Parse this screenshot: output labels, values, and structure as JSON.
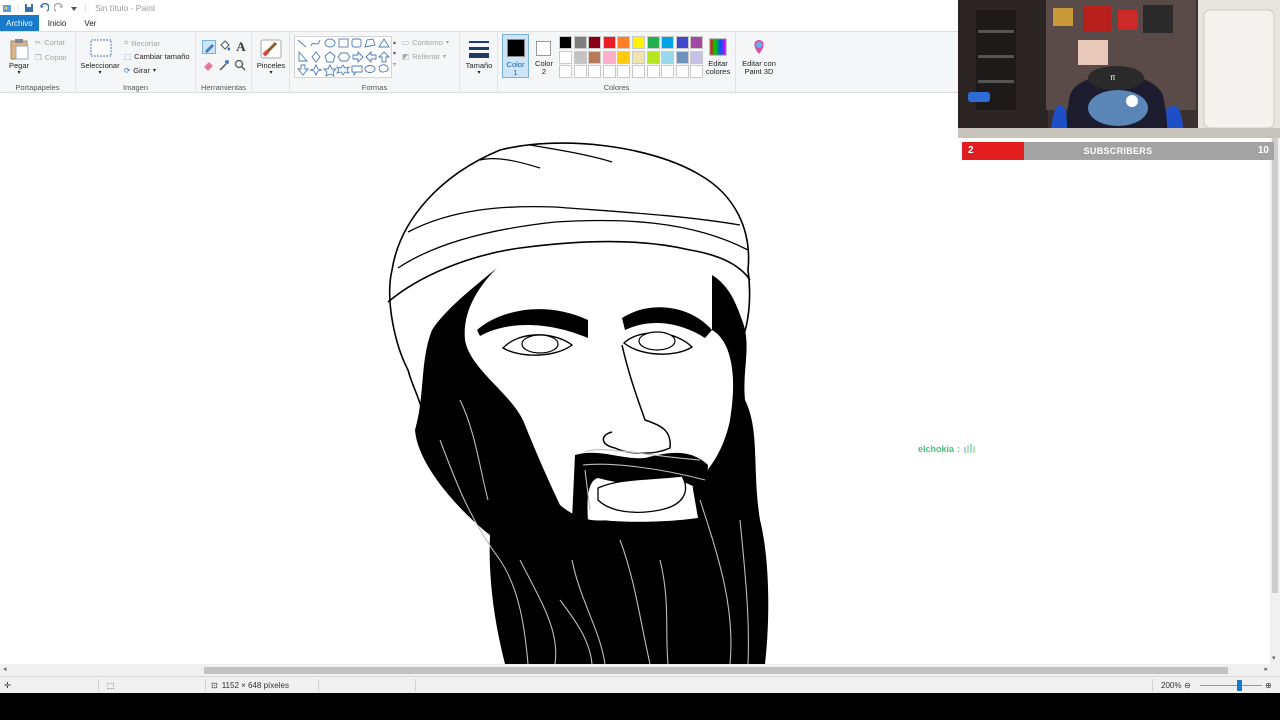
{
  "window": {
    "title": "Sin título - Paint"
  },
  "tabs": {
    "file": "Archivo",
    "home": "Inicio",
    "view": "Ver"
  },
  "ribbon": {
    "clipboard": {
      "paste": "Pegar",
      "cut": "Cortar",
      "copy": "Copiar",
      "label": "Portapapeles"
    },
    "image": {
      "select": "Seleccionar",
      "crop": "Recortar",
      "resize": "Cambiar tamaño",
      "rotate": "Girar",
      "label": "Imagen"
    },
    "tools": {
      "label": "Herramientas"
    },
    "brushes": {
      "label": "Pinceles"
    },
    "shapes": {
      "outline": "Contorno",
      "fill": "Rellenar",
      "label": "Formas"
    },
    "size": {
      "label": "Tamaño"
    },
    "colors": {
      "color1": "Color",
      "color1_num": "1",
      "color2": "Color",
      "color2_num": "2",
      "edit_colors_line1": "Editar",
      "edit_colors_line2": "colores",
      "paint3d_line1": "Editar con",
      "paint3d_line2": "Paint 3D",
      "label": "Colores",
      "color1_value": "#000000",
      "color2_value": "#ffffff",
      "palette_row1": [
        "#000000",
        "#7f7f7f",
        "#880015",
        "#ed1c24",
        "#ff7f27",
        "#fff200",
        "#22b14c",
        "#00a2e8",
        "#3f48cc",
        "#a349a4"
      ],
      "palette_row2": [
        "#ffffff",
        "#c3c3c3",
        "#b97a57",
        "#ffaec9",
        "#ffc90e",
        "#efe4b0",
        "#b5e61d",
        "#99d9ea",
        "#7092be",
        "#c8bfe7"
      ],
      "palette_row3": [
        "#ffffff",
        "#ffffff",
        "#ffffff",
        "#ffffff",
        "#ffffff",
        "#ffffff",
        "#ffffff",
        "#ffffff",
        "#ffffff",
        "#ffffff"
      ]
    }
  },
  "status": {
    "dimensions": "1152 × 648 píxeles",
    "zoom": "200%",
    "zoom_level": 0.65
  },
  "overlay": {
    "subscribers_label": "SUBSCRIBERS",
    "subscribers_current": "2",
    "subscribers_goal": "10",
    "subscribers_progress": 0.2,
    "chat_user": "elchokia",
    "chat_sep": ":"
  }
}
